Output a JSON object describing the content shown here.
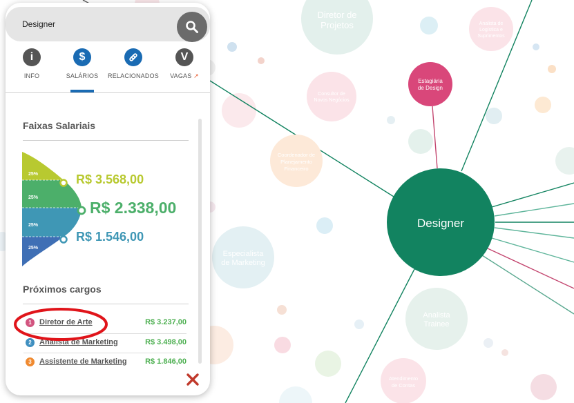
{
  "search": {
    "value": "Designer"
  },
  "tabs": [
    {
      "label": "INFO",
      "icon": "info-icon",
      "color": "#555555"
    },
    {
      "label": "SALÁRIOS",
      "icon": "dollar-icon",
      "color": "#1a6bb3"
    },
    {
      "label": "RELACIONADOS",
      "icon": "link-icon",
      "color": "#1a6bb3"
    },
    {
      "label": "VAGAS",
      "icon": "vagas-logo-icon",
      "color": "#555555"
    }
  ],
  "salary_ranges": {
    "title": "Faixas Salariais",
    "bands": [
      "25%",
      "25%",
      "25%",
      "25%"
    ],
    "high": "R$ 3.568,00",
    "median": "R$ 2.338,00",
    "low": "R$ 1.546,00",
    "colors": {
      "high": "#b8c930",
      "median": "#4caf6a",
      "low": "#3f97b5",
      "bottom": "#3f6fb5"
    }
  },
  "next_positions": {
    "title": "Próximos cargos",
    "items": [
      {
        "num": "1",
        "title": "Diretor de Arte",
        "salary": "R$ 3.237,00",
        "color": "#d2547f"
      },
      {
        "num": "2",
        "title": "Analista de Marketing",
        "salary": "R$ 3.498,00",
        "color": "#3f8fc0"
      },
      {
        "num": "3",
        "title": "Assistente de Marketing",
        "salary": "R$ 1.846,00",
        "color": "#f08a30"
      }
    ]
  },
  "graph": {
    "center": "Designer",
    "center_color": "#128360",
    "nodes": [
      {
        "label": "Diretor de\nProjetos"
      },
      {
        "label": "Analista de\nLogística e\nSuprimentos"
      },
      {
        "label": "Estagiária\nde Design"
      },
      {
        "label": "Consultor de\nNovos Negócios"
      },
      {
        "label": "Coordenador de\nPlanejamento\nFinanceiro"
      },
      {
        "label": "Especialista\nde Marketing"
      },
      {
        "label": "Analista\nTrainee"
      },
      {
        "label": "Atendimento\nde Contas"
      }
    ]
  }
}
